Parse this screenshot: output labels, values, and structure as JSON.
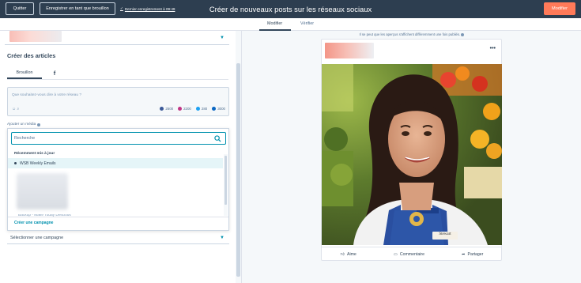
{
  "topbar": {
    "quit_label": "Quitter",
    "save_draft_label": "Enregistrer en tant que brouillon",
    "last_saved": "Dernier enregistrement à 09:49",
    "title": "Créer de nouveaux posts sur les réseaux sociaux",
    "publish_label": "Modifier"
  },
  "tabs": [
    {
      "label": "Modifier",
      "active": true
    },
    {
      "label": "Vérifier",
      "active": false
    }
  ],
  "editor": {
    "section_title": "Créer des articles",
    "subtabs": {
      "draft": "Brouillon",
      "facebook_icon": "f"
    },
    "compose_placeholder": "Que souhaitez-vous dire à votre réseau ?",
    "counters": [
      {
        "icon": "facebook",
        "value": "2500",
        "color": "#3b5998"
      },
      {
        "icon": "instagram",
        "value": "2200",
        "color": "#c13584"
      },
      {
        "icon": "twitter",
        "value": "280",
        "color": "#1da1f2"
      },
      {
        "icon": "linkedin",
        "value": "3000",
        "color": "#0a66c2"
      }
    ],
    "media_label": "Ajouter un média"
  },
  "dropdown": {
    "search_placeholder": "Recherche",
    "section_header": "Récemment mis à jour",
    "selected_item": "WSB Weekly Emails",
    "cut_off_item": "Backup - Make Today Delicious",
    "create_link": "Créer une campagne"
  },
  "campaign_select": {
    "placeholder": "Sélectionner une campagne"
  },
  "preview": {
    "note": "Il se peut que les aperçus s'affichent différemment une fois publiés.",
    "actions": {
      "like": "Aime",
      "comment": "Commentaire",
      "share": "Partager"
    },
    "apron_text": "Stewart"
  },
  "colors": {
    "topbar": "#2d3e50",
    "accent_orange": "#ff7a59",
    "link_teal": "#0091ae",
    "selected_row": "#e5f5f8"
  }
}
